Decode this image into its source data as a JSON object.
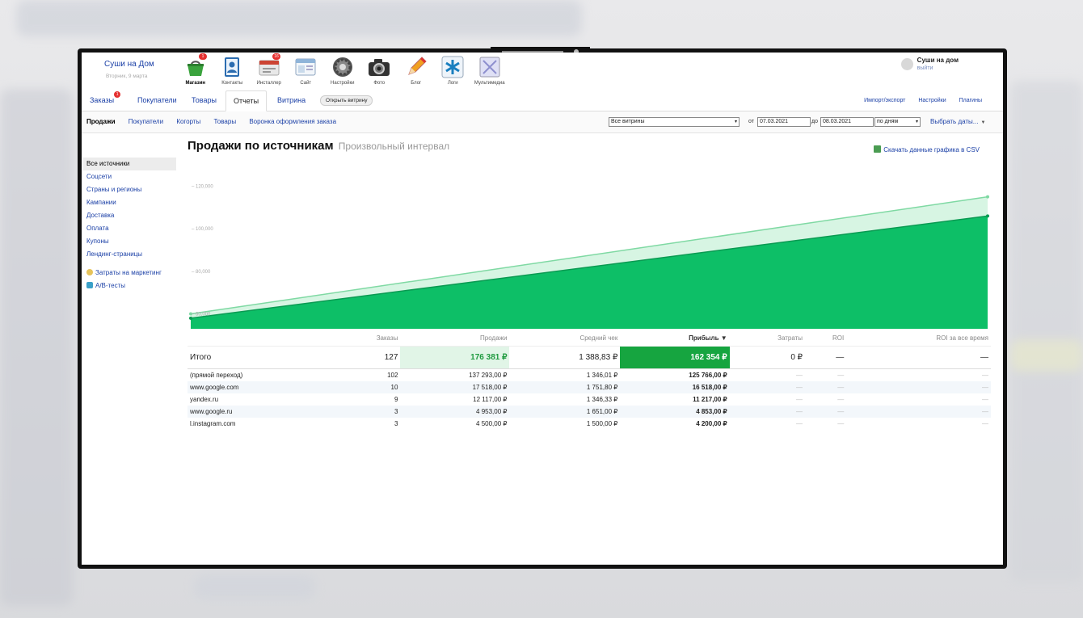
{
  "brand": {
    "name": "Суши на Дом",
    "date": "Вторник, 9 марта"
  },
  "apps": [
    {
      "label": "Магазин",
      "icon": "basket-icon",
      "badge": "1",
      "active": true
    },
    {
      "label": "Контакты",
      "icon": "contacts-icon"
    },
    {
      "label": "Инсталлер",
      "icon": "installer-icon",
      "badge": "16"
    },
    {
      "label": "Сайт",
      "icon": "site-icon"
    },
    {
      "label": "Настройки",
      "icon": "gear-icon"
    },
    {
      "label": "Фото",
      "icon": "camera-icon"
    },
    {
      "label": "Блог",
      "icon": "pencil-icon"
    },
    {
      "label": "Логи",
      "icon": "logs-icon"
    },
    {
      "label": "Мультимедиа",
      "icon": "multimedia-icon"
    }
  ],
  "user": {
    "name": "Суши на дом",
    "logout": "выйти"
  },
  "tabs": {
    "orders": "Заказы",
    "orders_badge": "1",
    "customers": "Покупатели",
    "products": "Товары",
    "reports": "Отчеты",
    "storefront": "Витрина",
    "open_store": "Открыть витрину"
  },
  "tabs_right": {
    "import": "Импорт/экспорт",
    "settings": "Настройки",
    "plugins": "Плагины"
  },
  "subnav": {
    "sales": "Продажи",
    "customers": "Покупатели",
    "cohorts": "Когорты",
    "products": "Товары",
    "funnel": "Воронка оформления заказа"
  },
  "filters": {
    "storefront": "Все витрины",
    "from_label": "от",
    "from": "07.03.2021",
    "to_label": "до",
    "to": "08.03.2021",
    "period": "по дням",
    "pick_dates": "Выбрать даты...",
    "caret": "▼"
  },
  "sidebar": {
    "items": [
      "Все источники",
      "Соцсети",
      "Страны и регионы",
      "Кампании",
      "Доставка",
      "Оплата",
      "Купоны",
      "Лендинг-страницы"
    ],
    "marketing": "Затраты на маркетинг",
    "ab": "A/B-тесты"
  },
  "page": {
    "title": "Продажи по источникам",
    "subtitle": "Произвольный интервал",
    "csv": "Скачать данные графика в CSV"
  },
  "chart_data": {
    "type": "area",
    "x": [
      "07.03.2021",
      "08.03.2021"
    ],
    "y_ticks": [
      "120,000",
      "100,000",
      "80,000",
      "60,000"
    ],
    "ylim": [
      53000,
      127000
    ],
    "series": [
      {
        "values": [
          60000,
          115000
        ],
        "color": "#d7f5e3"
      },
      {
        "values": [
          58000,
          106000
        ],
        "color": "#0dbf67"
      }
    ],
    "grid": false
  },
  "table": {
    "headers": [
      "",
      "Заказы",
      "Продажи",
      "Средний чек",
      "Прибыль ▼",
      "Затраты",
      "ROI",
      "ROI за все время"
    ],
    "total": [
      "Итого",
      "127",
      "176 381 ₽",
      "1 388,83 ₽",
      "162 354 ₽",
      "0 ₽",
      "—",
      "—"
    ],
    "rows": [
      [
        "(прямой переход)",
        "102",
        "137 293,00 ₽",
        "1 346,01 ₽",
        "125 766,00 ₽",
        "—",
        "—",
        "—"
      ],
      [
        "www.google.com",
        "10",
        "17 518,00 ₽",
        "1 751,80 ₽",
        "16 518,00 ₽",
        "—",
        "—",
        "—"
      ],
      [
        "yandex.ru",
        "9",
        "12 117,00 ₽",
        "1 346,33 ₽",
        "11 217,00 ₽",
        "—",
        "—",
        "—"
      ],
      [
        "www.google.ru",
        "3",
        "4 953,00 ₽",
        "1 651,00 ₽",
        "4 853,00 ₽",
        "—",
        "—",
        "—"
      ],
      [
        "l.instagram.com",
        "3",
        "4 500,00 ₽",
        "1 500,00 ₽",
        "4 200,00 ₽",
        "—",
        "—",
        "—"
      ]
    ]
  }
}
